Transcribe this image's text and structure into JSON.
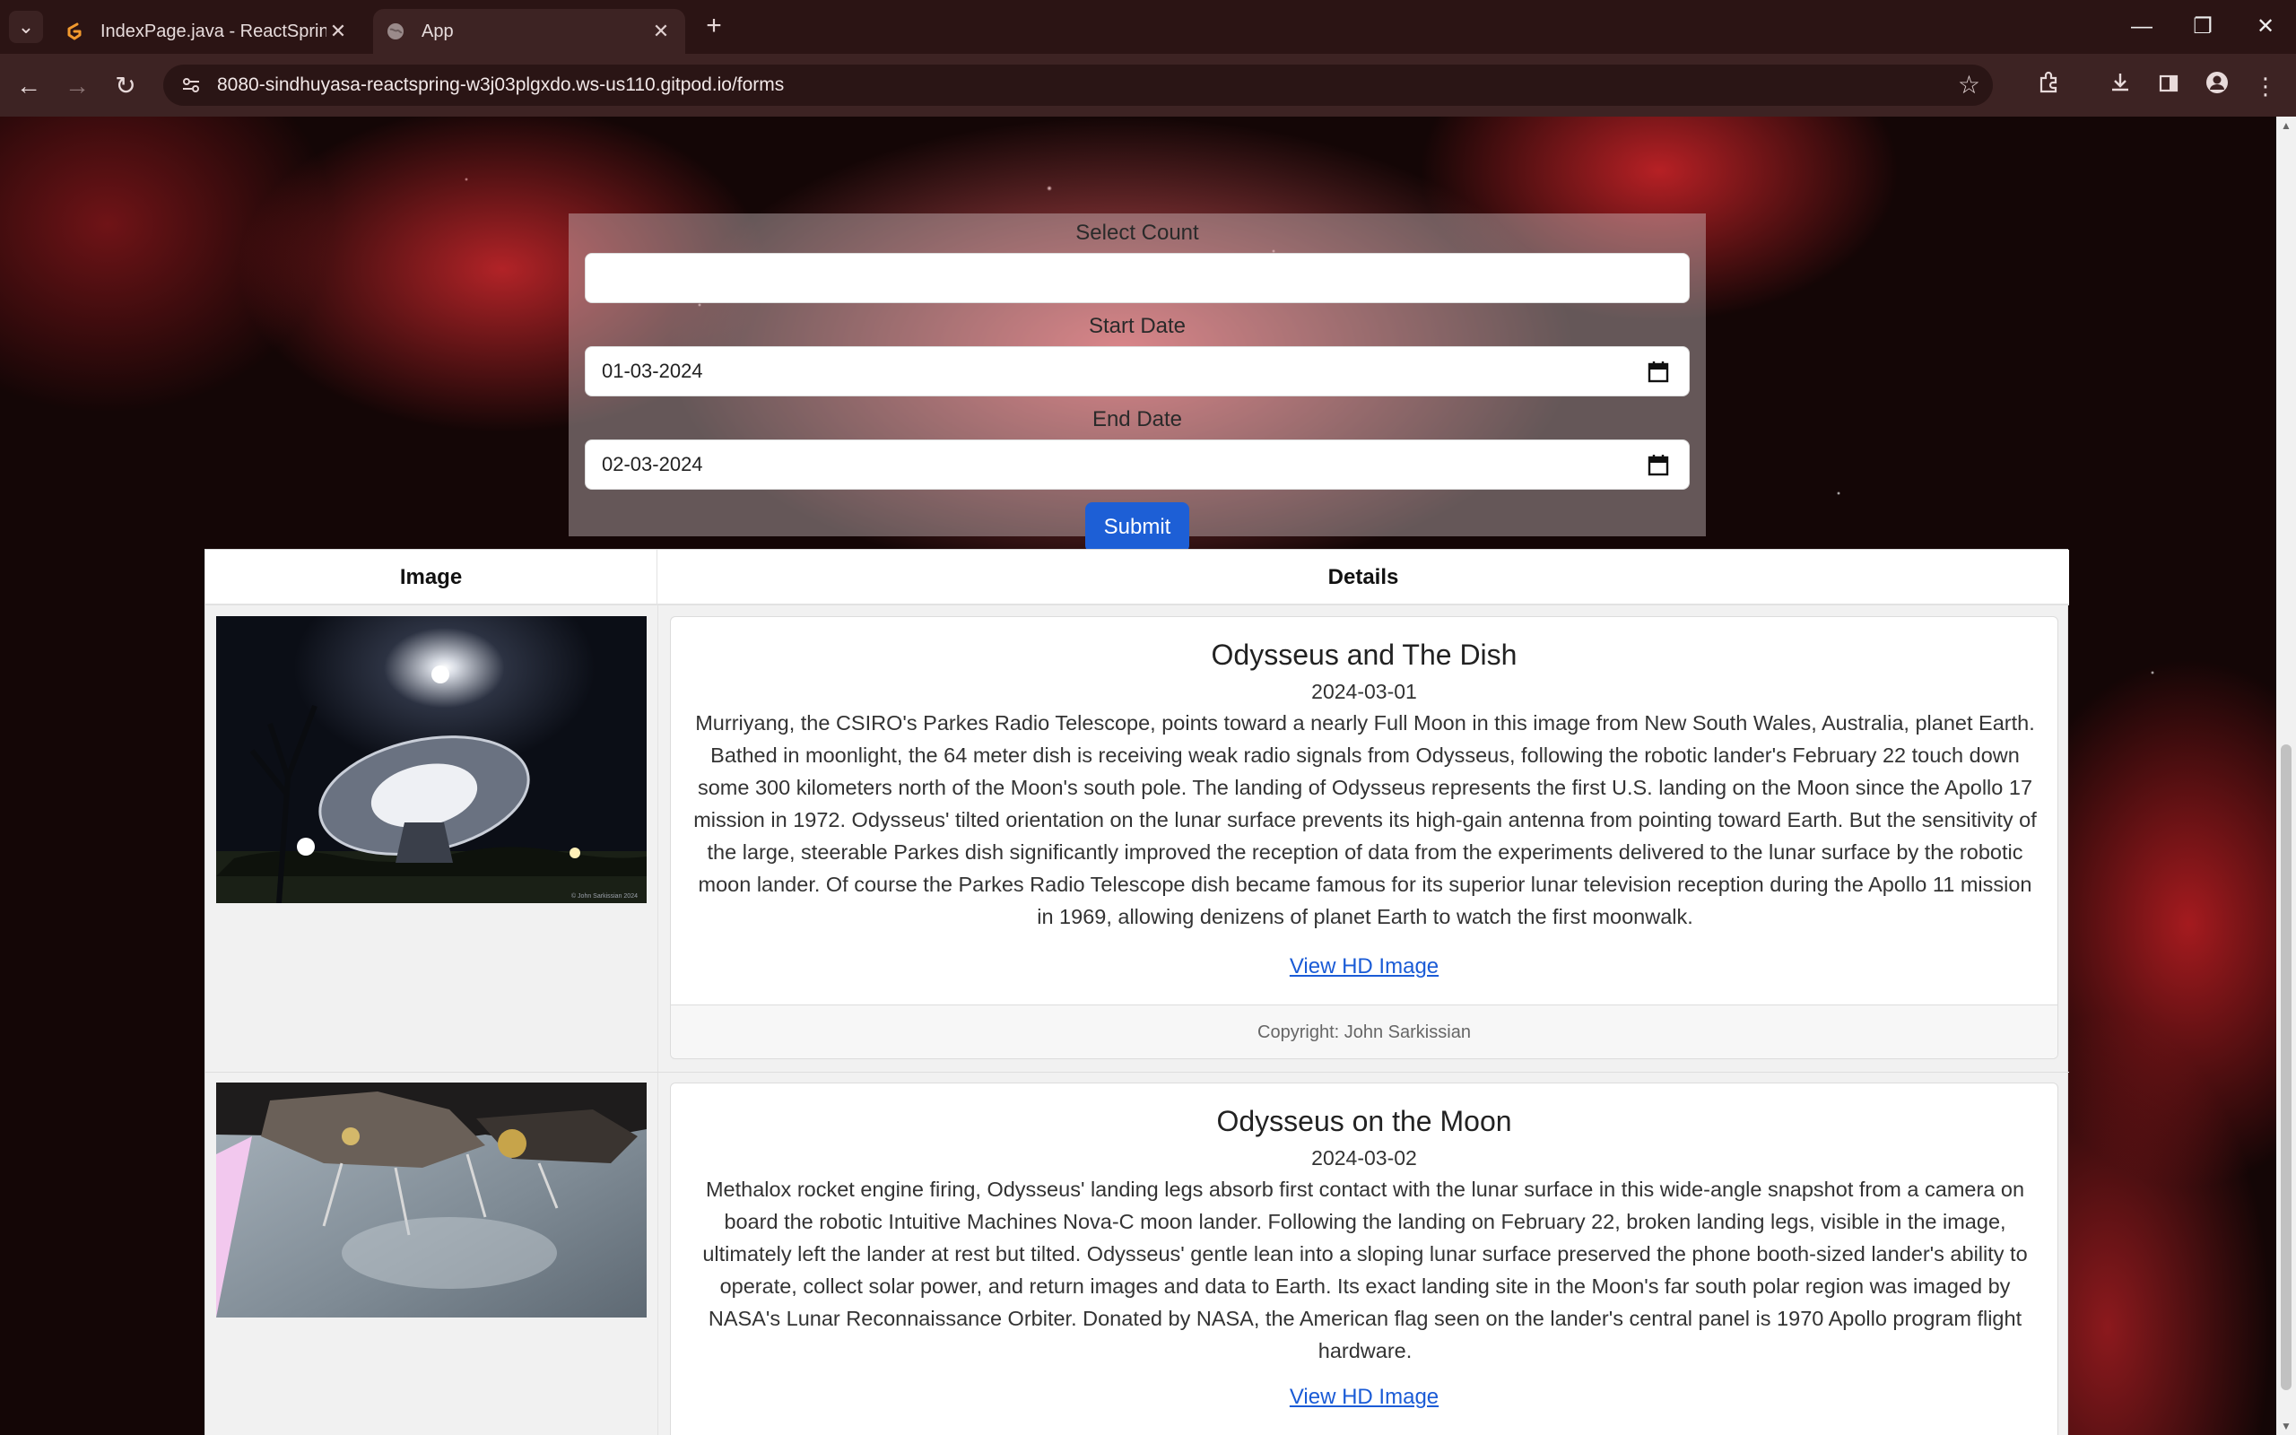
{
  "browser": {
    "tabs": [
      {
        "title": "IndexPage.java - ReactSpring - G",
        "favicon": "gitpod-icon",
        "active": false
      },
      {
        "title": "App",
        "favicon": "globe-icon",
        "active": true
      }
    ],
    "url": "8080-sindhuyasa-reactspring-w3j03plgxdo.ws-us110.gitpod.io/forms",
    "toolbar_icons": [
      "back-icon",
      "forward-icon",
      "reload-icon",
      "site-info-icon",
      "bookmark-star-icon",
      "extensions-icon",
      "download-icon",
      "side-panel-icon",
      "profile-icon",
      "menu-icon"
    ]
  },
  "form": {
    "count_label": "Select Count",
    "count_value": "",
    "start_label": "Start Date",
    "start_value": "01-03-2024",
    "end_label": "End Date",
    "end_value": "02-03-2024",
    "submit_label": "Submit"
  },
  "table": {
    "headers": {
      "image": "Image",
      "details": "Details"
    },
    "rows": [
      {
        "title": "Odysseus and The Dish",
        "date": "2024-03-01",
        "explanation": "Murriyang, the CSIRO's Parkes Radio Telescope, points toward a nearly Full Moon in this image from New South Wales, Australia, planet Earth. Bathed in moonlight, the 64 meter dish is receiving weak radio signals from Odysseus, following the robotic lander's February 22 touch down some 300 kilometers north of the Moon's south pole. The landing of Odysseus represents the first U.S. landing on the Moon since the Apollo 17 mission in 1972. Odysseus' tilted orientation on the lunar surface prevents its high-gain antenna from pointing toward Earth. But the sensitivity of the large, steerable Parkes dish significantly improved the reception of data from the experiments delivered to the lunar surface by the robotic moon lander. Of course the Parkes Radio Telescope dish became famous for its superior lunar television reception during the Apollo 11 mission in 1969, allowing denizens of planet Earth to watch the first moonwalk.",
        "link_label": "View HD Image",
        "copyright": "Copyright: John Sarkissian",
        "image_watermark": "© John Sarkissian 2024"
      },
      {
        "title": "Odysseus on the Moon",
        "date": "2024-03-02",
        "explanation": "Methalox rocket engine firing, Odysseus' landing legs absorb first contact with the lunar surface in this wide-angle snapshot from a camera on board the robotic Intuitive Machines Nova-C moon lander. Following the landing on February 22, broken landing legs, visible in the image, ultimately left the lander at rest but tilted. Odysseus' gentle lean into a sloping lunar surface preserved the phone booth-sized lander's ability to operate, collect solar power, and return images and data to Earth. Its exact landing site in the Moon's far south polar region was imaged by NASA's Lunar Reconnaissance Orbiter. Donated by NASA, the American flag seen on the lander's central panel is 1970 Apollo program flight hardware.",
        "link_label": "View HD Image"
      }
    ]
  }
}
